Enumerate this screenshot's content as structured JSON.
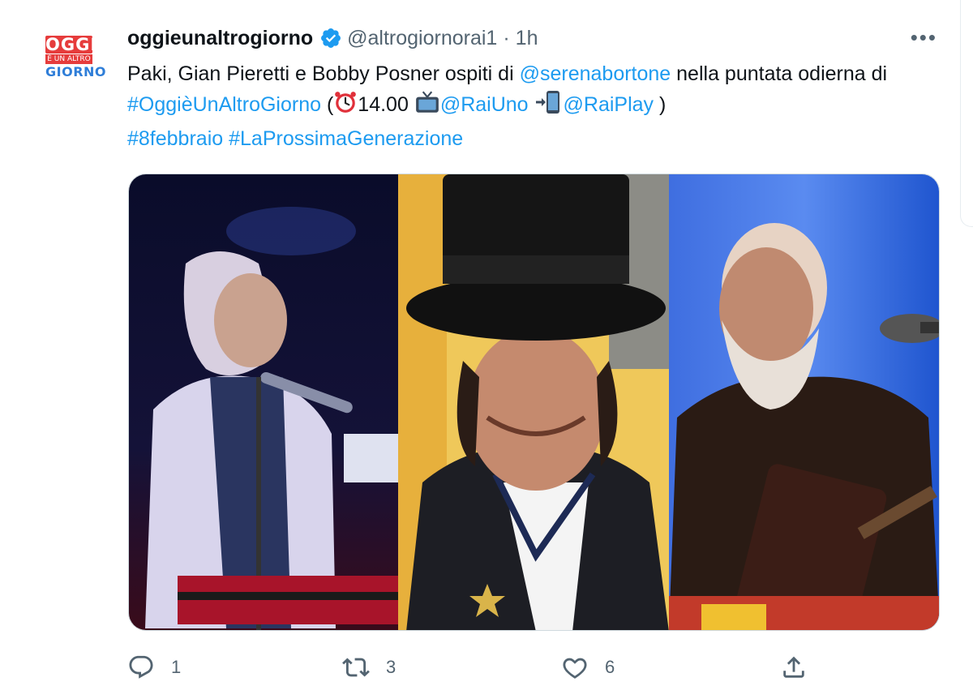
{
  "account": {
    "display_name": "oggieunaltrogiorno",
    "handle": "@altrogiornorai1",
    "separator": "·",
    "time": "1h",
    "avatar_logo": {
      "line1": "OGGI",
      "line2": "È UN ALTRO",
      "line3": "GIORNO"
    }
  },
  "tweet": {
    "t1": "Paki, Gian Pieretti e Bobby Posner ospiti di ",
    "mention_host": "@serenabortone",
    "t2": " nella puntata odierna di ",
    "hashtag_show": "#OggièUnAltroGiorno",
    "t3": " (",
    "time_text": "14.00 ",
    "mention_channel": "@RaiUno",
    "mention_play": "@RaiPlay",
    "t4": " )",
    "hashtag_date": "#8febbraio",
    "hashtag_gen": "#LaProssimaGenerazione"
  },
  "media": {
    "panels": [
      "photo-keyboard-singer",
      "photo-top-hat-man",
      "photo-bearded-guitarist"
    ]
  },
  "actions": {
    "reply": {
      "icon": "reply-icon",
      "count": "1"
    },
    "retweet": {
      "icon": "retweet-icon",
      "count": "3"
    },
    "like": {
      "icon": "heart-icon",
      "count": "6"
    },
    "share": {
      "icon": "share-icon"
    }
  },
  "colors": {
    "link": "#1d9bf0",
    "text": "#0f1419",
    "muted": "#536471",
    "verified": "#1d9bf0"
  }
}
